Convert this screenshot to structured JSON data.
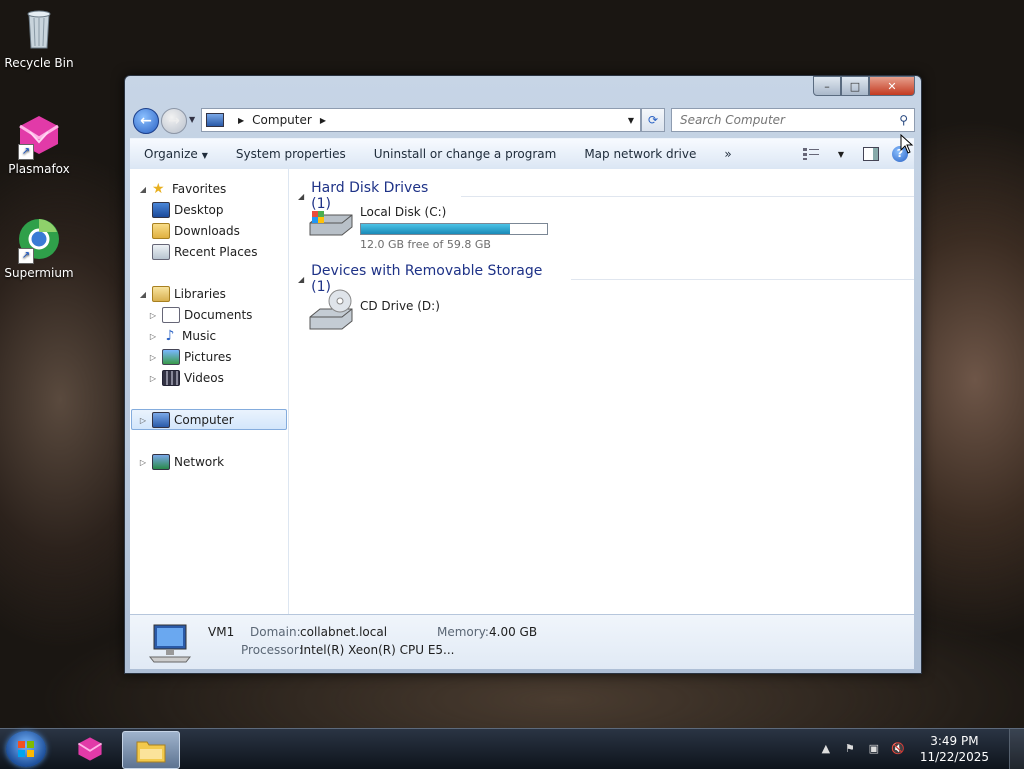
{
  "desktop": {
    "icons": [
      {
        "label": "Recycle Bin",
        "icon": "recycle-bin-icon"
      },
      {
        "label": "Plasmafox",
        "icon": "plasmafox-icon"
      },
      {
        "label": "Supermium",
        "icon": "supermium-icon"
      }
    ]
  },
  "window": {
    "controls": {
      "minimize": "–",
      "maximize": "□",
      "close": "✕"
    },
    "address": {
      "location": "Computer"
    },
    "search": {
      "placeholder": "Search Computer"
    },
    "toolbar": {
      "organize": "Organize",
      "system_properties": "System properties",
      "uninstall": "Uninstall or change a program",
      "map_drive": "Map network drive",
      "more": "»"
    },
    "nav": {
      "favorites": "Favorites",
      "desktop": "Desktop",
      "downloads": "Downloads",
      "recent_places": "Recent Places",
      "libraries": "Libraries",
      "documents": "Documents",
      "music": "Music",
      "pictures": "Pictures",
      "videos": "Videos",
      "computer": "Computer",
      "network": "Network"
    },
    "groups": {
      "hard_disks": "Hard Disk Drives (1)",
      "removable": "Devices with Removable Storage (1)"
    },
    "drives": {
      "c": {
        "name": "Local Disk (C:)",
        "free_text": "12.0 GB free of 59.8 GB",
        "used_fraction": 0.8
      },
      "d": {
        "name": "CD Drive (D:)"
      }
    },
    "details": {
      "name": "VM1",
      "domain_label": "Domain:",
      "domain_value": "collabnet.local",
      "memory_label": "Memory:",
      "memory_value": "4.00 GB",
      "processor_label": "Processor:",
      "processor_value": "Intel(R) Xeon(R) CPU E5..."
    }
  },
  "taskbar": {
    "time": "3:49 PM",
    "date": "11/22/2025"
  },
  "colors": {
    "accent": "#1e3287",
    "selection": "#d3e6fb",
    "bar_fill": "#26a0da"
  }
}
